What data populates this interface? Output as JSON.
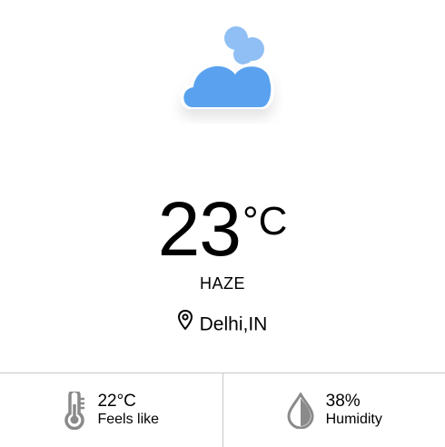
{
  "weather": {
    "icon": "cloudy-icon",
    "temperature": "23",
    "unit": "°C",
    "condition": "HAZE",
    "location": "Delhi,IN"
  },
  "stats": {
    "feels_like": {
      "icon": "thermometer-icon",
      "value": "22°C",
      "label": "Feels like"
    },
    "humidity": {
      "icon": "humidity-drop-icon",
      "value": "38%",
      "label": "Humidity"
    }
  },
  "colors": {
    "cloud_main": "#5aa2ef",
    "cloud_back": "#8fbff4",
    "icon_gray": "#8a8a8a",
    "divider": "#c9c9c9"
  }
}
